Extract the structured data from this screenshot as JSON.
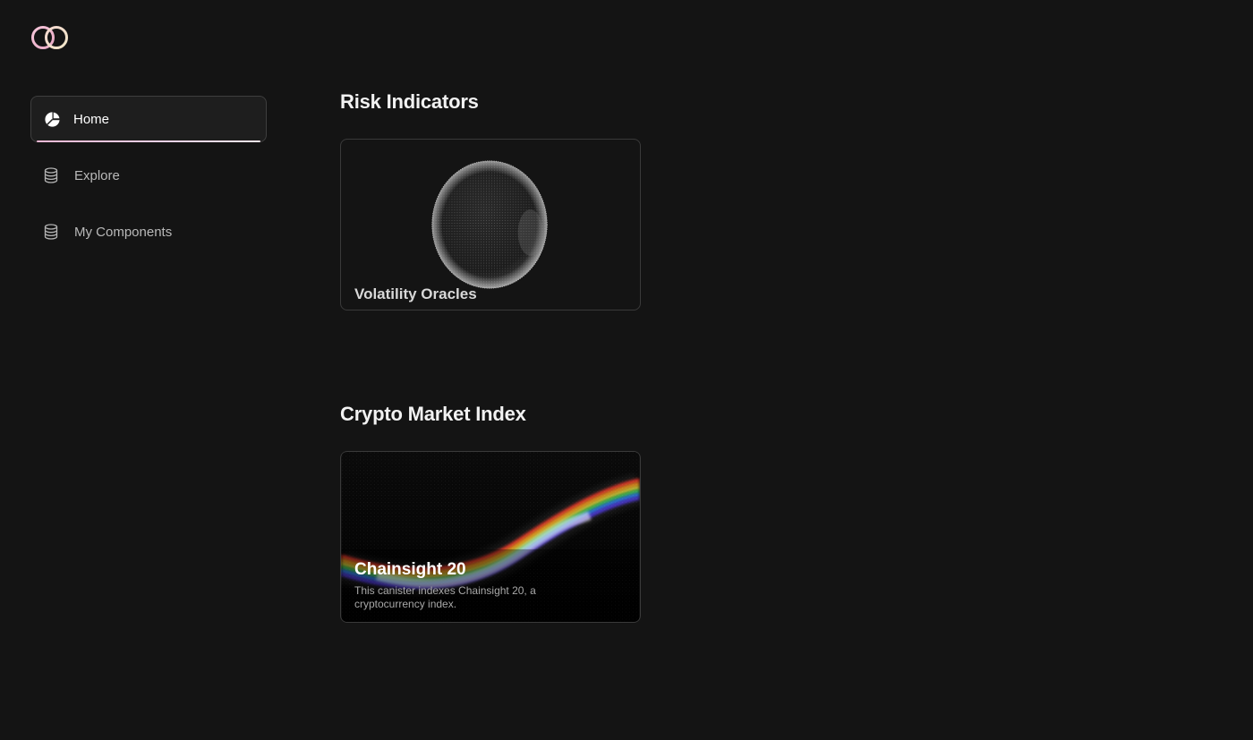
{
  "brand": {
    "logo_icon": "interlocked-rings-icon",
    "accent": "#f6b9d6"
  },
  "sidebar": {
    "items": [
      {
        "label": "Home",
        "icon": "pie-chart-icon",
        "active": true
      },
      {
        "label": "Explore",
        "icon": "database-icon",
        "active": false
      },
      {
        "label": "My Components",
        "icon": "database-icon",
        "active": false
      }
    ]
  },
  "sections": [
    {
      "title": "Risk Indicators",
      "cards": [
        {
          "title": "Volatility Oracles",
          "art": "dotted-sphere"
        }
      ]
    },
    {
      "title": "Crypto Market Index",
      "cards": [
        {
          "title": "Chainsight 20",
          "description": "This canister indexes Chainsight 20, a cryptocurrency index.",
          "art": "rainbow-wave"
        }
      ]
    }
  ]
}
